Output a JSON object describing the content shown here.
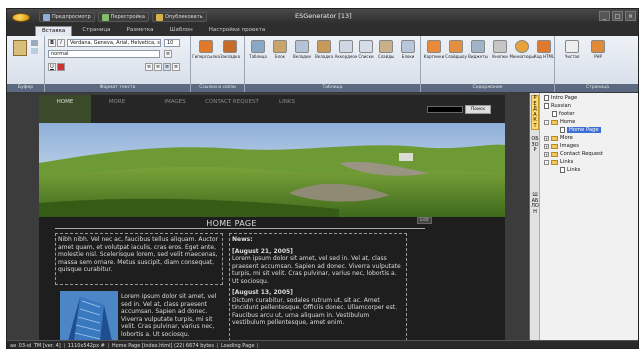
{
  "window": {
    "title": "ESGenerator  [13]"
  },
  "quick_access": [
    {
      "label": "Предпросмотр",
      "icon": "preview-icon"
    },
    {
      "label": "Перестройка",
      "icon": "rebuild-icon"
    },
    {
      "label": "Опубликовать",
      "icon": "publish-icon"
    }
  ],
  "tabs": [
    "Вставка",
    "Страница",
    "Разметка",
    "Шаблон",
    "Настройки проекта"
  ],
  "ribbon": {
    "font_family": "Verdana, Geneva, Arial, Helvetica, sa",
    "font_size": "10",
    "style": "normal",
    "bold": "B",
    "italic": "I",
    "underline": "U",
    "groups": [
      {
        "label": "Буфер"
      },
      {
        "label": "Формат текста"
      },
      {
        "label": "Ссылки и связи"
      },
      {
        "label": "Таблица"
      },
      {
        "label": "Содержание"
      },
      {
        "label": "Страница"
      }
    ],
    "buttons": [
      {
        "label": "Гиперссылка",
        "color": "#e07a2a"
      },
      {
        "label": "Закладка",
        "color": "#c86a2a"
      },
      {
        "label": "Таблица",
        "color": "#8aa7c8"
      },
      {
        "label": "Блок",
        "color": "#c9a56a"
      },
      {
        "label": "Вкладки",
        "color": "#b6c3d6"
      },
      {
        "label": "Вкладка",
        "color": "#c89a5a"
      },
      {
        "label": "Аккордеон",
        "color": "#cfd8e4"
      },
      {
        "label": "Списки",
        "color": "#d5dde8"
      },
      {
        "label": "Слайды",
        "color": "#c7b08a"
      },
      {
        "label": "Блоки",
        "color": "#b7c6d8"
      },
      {
        "label": "Картинки",
        "color": "#e98a3a"
      },
      {
        "label": "Слайдшоу",
        "color": "#e38f42"
      },
      {
        "label": "Виджеты",
        "color": "#9fb3c9"
      },
      {
        "label": "Кнопки",
        "color": "#c6c6c6"
      },
      {
        "label": "Миниатюры",
        "color": "#e8a23a"
      },
      {
        "label": "Код HTML",
        "color": "#e0792e"
      },
      {
        "label": "Чистая",
        "color": "#eeeeee"
      },
      {
        "label": "PHP",
        "color": "#e08a3a"
      }
    ]
  },
  "site": {
    "nav": [
      "HOME",
      "MORE",
      "IMAGES",
      "CONTACT REQUEST",
      "LINKS"
    ],
    "search_button": "Поиск",
    "edit": "Edit",
    "page_title": "HOME PAGE",
    "intro_text": "Nibh nibh. Vel nec ac, faucibus tellus aliquam. Auctor amet quam, et volutpat iaculis, cras eros. Eget ante, molestie nisl. Scelerisque lorem, sed velit maecenas, massa sem ornare. Metus suscipit, diam consequat, quisque curabitur.",
    "image_text": "Lorem ipsum dolor sit amet, vel sed in. Vel at, class praesent accumsan. Sapien ad donec. Viverra vulputate turpis, mi sit velit. Cras pulvinar, varius nec, lobortis a. Ut sociosqu.",
    "news_title": "News:",
    "news": [
      {
        "date": "[August 21, 2005]",
        "text": "Lorem ipsum dolor sit amet, vel sed in. Vel at, class praesent accumsan. Sapien ad donec. Viverra vulputate turpis, mi sit velit. Cras pulvinar, varius nec, lobortis a. Ut sociosqu."
      },
      {
        "date": "[August 13, 2005]",
        "text": "Dictum curabitur, sodales rutrum ut, sit ac. Amet tincidunt pellentesque. Officiis donec. Ullamcorper est. Faucibus arcu ut, urna aliquam in. Vestibulum vestibulum pellentesque, amet enim."
      }
    ]
  },
  "side_tabs": [
    "РЕДАКТ",
    "ОБЗОР",
    "ШАБЛОН"
  ],
  "tree": [
    {
      "label": "Intro Page",
      "type": "doc",
      "depth": 0
    },
    {
      "label": "Russian",
      "type": "doc",
      "depth": 0
    },
    {
      "label": "footer",
      "type": "doc",
      "depth": 1
    },
    {
      "label": "Home",
      "type": "folder",
      "depth": 1
    },
    {
      "label": "Home Page",
      "type": "doc",
      "depth": 2,
      "selected": true
    },
    {
      "label": "More",
      "type": "folder",
      "depth": 1
    },
    {
      "label": "Images",
      "type": "folder",
      "depth": 1
    },
    {
      "label": "Contact Request",
      "type": "folder",
      "depth": 1
    },
    {
      "label": "Links",
      "type": "folder",
      "depth": 1
    },
    {
      "label": "Links",
      "type": "doc",
      "depth": 2
    }
  ],
  "status": [
    "ae_03-ol_TM [ver. 4]",
    "1110x542px #",
    "Home Page [index.html] (22) 6674 bytes",
    "Loading Page"
  ]
}
